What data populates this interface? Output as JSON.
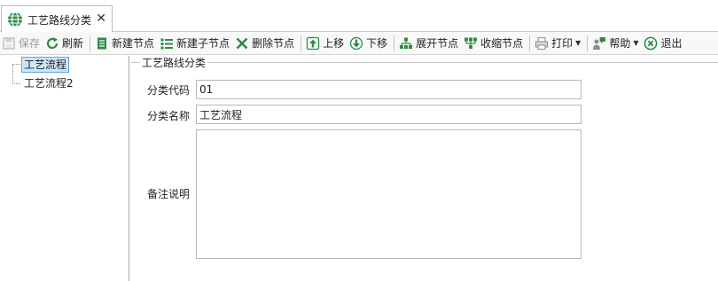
{
  "tab": {
    "title": "工艺路线分类",
    "close": "✕"
  },
  "toolbar": {
    "save": "保存",
    "refresh": "刷新",
    "new_node": "新建节点",
    "new_child": "新建子节点",
    "delete_node": "删除节点",
    "move_up": "上移",
    "move_down": "下移",
    "expand": "展开节点",
    "collapse": "收缩节点",
    "print": "打印",
    "help": "帮助",
    "exit": "退出"
  },
  "tree": {
    "items": [
      {
        "label": "工艺流程",
        "selected": true
      },
      {
        "label": "工艺流程2",
        "selected": false
      }
    ]
  },
  "form": {
    "group_title": "工艺路线分类",
    "code_label": "分类代码",
    "code_value": "01",
    "name_label": "分类名称",
    "name_value": "工艺流程",
    "note_label": "备注说明",
    "note_value": ""
  },
  "colors": {
    "selection_bg": "#cde6f7",
    "selection_border": "#56a7e0",
    "icon_green": "#2f8a43",
    "icon_blue": "#2a6fb0"
  }
}
